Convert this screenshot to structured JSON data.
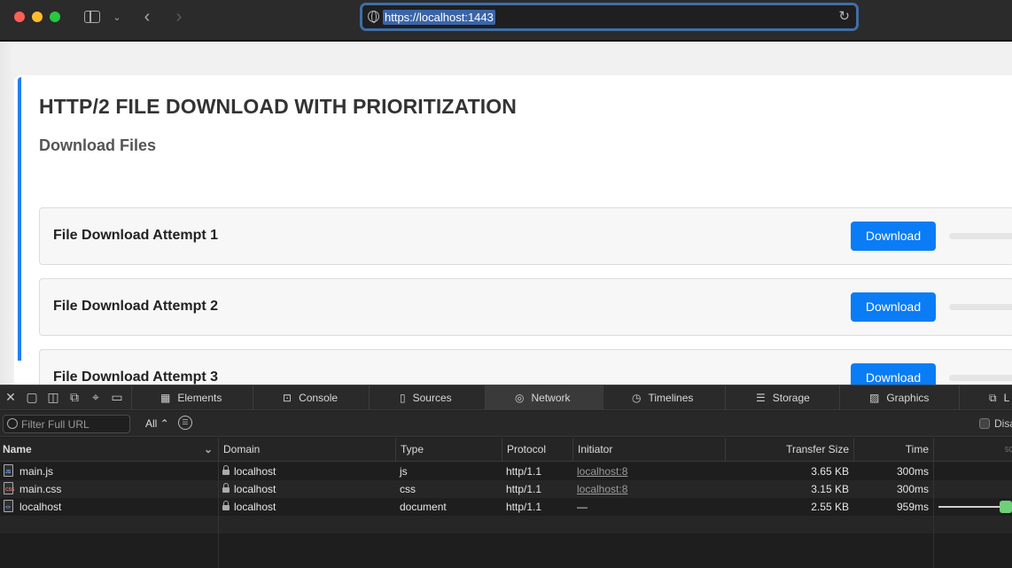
{
  "browser": {
    "url": "https://localhost:1443",
    "colors": {
      "url_focus_ring": "#3f6ea6",
      "close": "#ff5f57",
      "minimize": "#febc2e",
      "zoom": "#28c840"
    }
  },
  "page": {
    "title": "HTTP/2 FILE DOWNLOAD WITH PRIORITIZATION",
    "section_title": "Download Files",
    "accent_color": "#1f7ff7",
    "downloads": [
      {
        "label": "File Download Attempt 1",
        "button": "Download"
      },
      {
        "label": "File Download Attempt 2",
        "button": "Download"
      },
      {
        "label": "File Download Attempt 3",
        "button": "Download"
      }
    ]
  },
  "devtools": {
    "tabs": [
      {
        "label": "Elements",
        "icon": "elements-icon"
      },
      {
        "label": "Console",
        "icon": "console-icon"
      },
      {
        "label": "Sources",
        "icon": "sources-icon"
      },
      {
        "label": "Network",
        "icon": "network-icon",
        "active": true
      },
      {
        "label": "Timelines",
        "icon": "timelines-icon"
      },
      {
        "label": "Storage",
        "icon": "storage-icon"
      },
      {
        "label": "Graphics",
        "icon": "graphics-icon"
      },
      {
        "label": "L",
        "icon": "layers-icon"
      }
    ],
    "filter_placeholder": "Filter Full URL",
    "type_select": "All ⌃",
    "disable_cache_label": "Disa",
    "columns": [
      "Name",
      "Domain",
      "Type",
      "Protocol",
      "Initiator",
      "Transfer Size",
      "Time"
    ],
    "rows": [
      {
        "name": "main.js",
        "file_tag": "JS",
        "domain": "localhost",
        "type": "js",
        "protocol": "http/1.1",
        "initiator": "localhost:8",
        "size": "3.65 KB",
        "time": "300ms"
      },
      {
        "name": "main.css",
        "file_tag": "CSS",
        "domain": "localhost",
        "type": "css",
        "protocol": "http/1.1",
        "initiator": "localhost:8",
        "size": "3.15 KB",
        "time": "300ms"
      },
      {
        "name": "localhost",
        "file_tag": "<>",
        "domain": "localhost",
        "type": "document",
        "protocol": "http/1.1",
        "initiator": "—",
        "size": "2.55 KB",
        "time": "959ms"
      }
    ],
    "waterfall_tick": "50"
  }
}
